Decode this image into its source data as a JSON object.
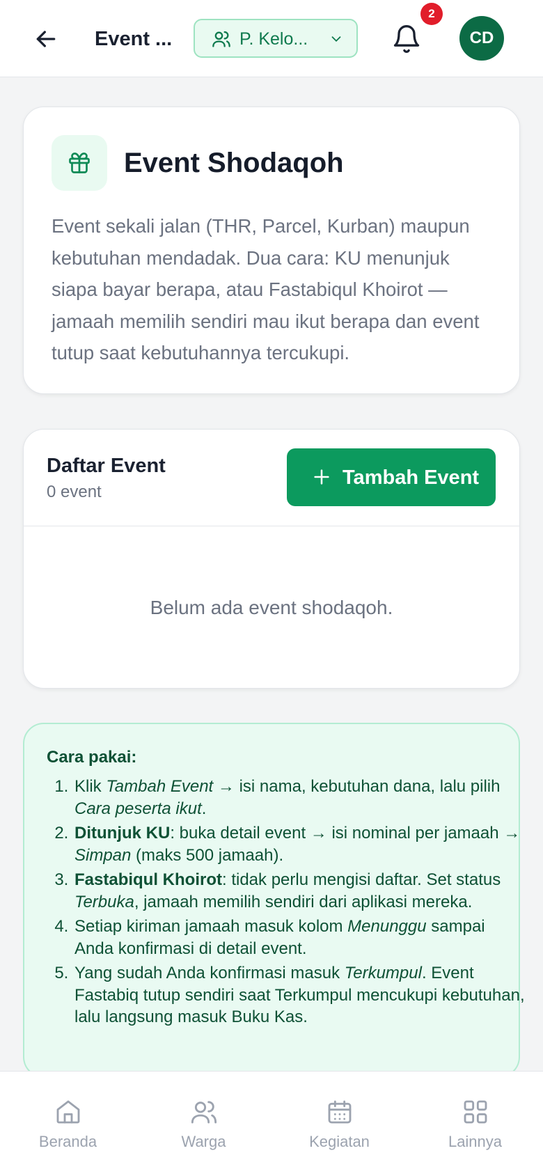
{
  "header": {
    "back_icon": "arrow-left-icon",
    "title": "Event ...",
    "org_select": {
      "icon": "users-icon",
      "value": "P. Kelo...",
      "chevron": "chevron-down-icon"
    },
    "notifications": {
      "icon": "bell-icon",
      "count": "2"
    },
    "avatar_initials": "CD"
  },
  "intro": {
    "icon": "gift-icon",
    "title": "Event Shodaqoh",
    "description": "Event sekali jalan (THR, Parcel, Kurban) maupun kebutuhan mendadak. Dua cara: KU menunjuk siapa bayar berapa, atau Fastabiqul Khoirot — jamaah memilih sendiri mau ikut berapa dan event tutup saat kebutuhannya tercukupi."
  },
  "event_list": {
    "title": "Daftar Event",
    "count_label": "0 event",
    "add_button": "Tambah Event",
    "empty_text": "Belum ada event shodaqoh."
  },
  "help": {
    "title": "Cara pakai:",
    "steps": [
      {
        "a": "Klik ",
        "b": "Tambah Event",
        "c": " → isi nama, kebutuhan dana, lalu pilih ",
        "d": "Cara peserta ikut",
        "e": "."
      },
      {
        "a": "Ditunjuk KU",
        "b": ": buka detail event → isi nominal per jamaah → ",
        "c": "Simpan",
        "d": " (maks 500 jamaah)."
      },
      {
        "a": "Fastabiqul Khoirot",
        "b": ": tidak perlu mengisi daftar. Set status ",
        "c": "Terbuka",
        "d": ", jamaah memilih sendiri dari aplikasi mereka."
      },
      {
        "a": "Setiap kiriman jamaah masuk kolom ",
        "b": "Menunggu",
        "c": " sampai Anda konfirmasi di detail event."
      },
      {
        "a": "Yang sudah Anda konfirmasi masuk ",
        "b": "Terkumpul",
        "c": ". Event Fastabiq tutup sendiri saat Terkumpul mencukupi kebutuhan, lalu langsung masuk Buku Kas."
      }
    ]
  },
  "bottom_nav": [
    {
      "label": "Beranda",
      "icon": "home-icon"
    },
    {
      "label": "Warga",
      "icon": "users-icon"
    },
    {
      "label": "Kegiatan",
      "icon": "calendar-icon"
    },
    {
      "label": "Lainnya",
      "icon": "grid-icon"
    }
  ]
}
